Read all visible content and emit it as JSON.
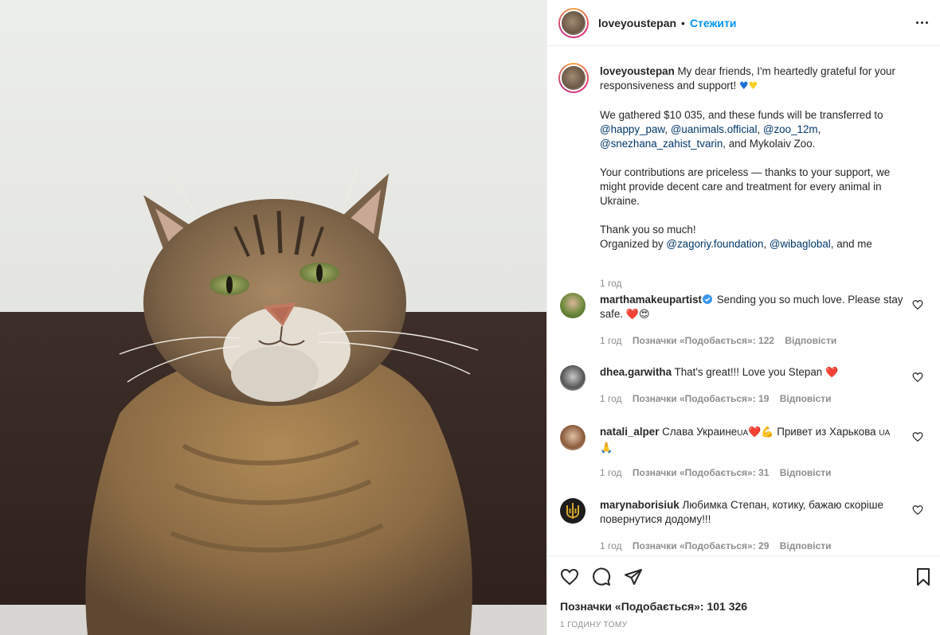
{
  "post": {
    "username": "loveyoustepan",
    "separator": "•",
    "follow_label": "Стежити",
    "caption": {
      "username": "loveyoustepan",
      "p1": "My dear friends, I'm heartedly grateful for your responsiveness and support!",
      "p2_start": "We gathered $10 035, and these funds will be transferred to",
      "mentions_1": [
        "@happy_paw",
        "@uanimals.official",
        "@zoo_12m",
        "@snezhana_zahist_tvarin"
      ],
      "p2_end": ", and Mykolaiv Zoo.",
      "p3": "Your contributions are priceless — thanks to your support, we might provide decent care and treatment for every animal in Ukraine.",
      "p4": "Thank you so much!",
      "p5_start": "Organized by",
      "mentions_2": [
        "@zagoriy.foundation",
        "@wibaglobal"
      ],
      "p5_end": ", and me",
      "time": "1 год"
    },
    "comments": [
      {
        "username": "marthamakeupartist",
        "verified": true,
        "text": "Sending you so much love. Please stay safe.",
        "emoji": "❤️😍",
        "time": "1 год",
        "likes": "Позначки «Подобається»: 122",
        "reply": "Відповісти"
      },
      {
        "username": "dhea.garwitha",
        "verified": false,
        "text": "That's great!!! Love you Stepan",
        "emoji": "❤️",
        "time": "1 год",
        "likes": "Позначки «Подобається»: 19",
        "reply": "Відповісти"
      },
      {
        "username": "natali_alper",
        "verified": false,
        "text_a": "Слава Украине",
        "flag_a": "UA",
        "emoji_a": "❤️💪",
        "text_b": "Привет из Харькова",
        "flag_b": "UA",
        "emoji_b": "🙏",
        "time": "1 год",
        "likes": "Позначки «Подобається»: 31",
        "reply": "Відповісти"
      },
      {
        "username": "marynaborisiuk",
        "verified": false,
        "text": "Любимка Степан, котику, бажаю скоріше повернутися додому!!!",
        "time": "1 год",
        "likes": "Позначки «Подобається»: 29",
        "reply": "Відповісти"
      }
    ],
    "likes_total": "Позначки «Подобається»: 101 326",
    "posted": "1 ГОДИНУ ТОМУ"
  },
  "icons": {
    "like": "heart-outline-icon",
    "comment": "comment-bubble-icon",
    "share": "paper-plane-icon",
    "save": "bookmark-icon",
    "more": "more-dots-icon",
    "verified": "verified-badge-icon"
  },
  "colors": {
    "link": "#00376b",
    "follow": "#0095f6",
    "muted": "#8e8e8e",
    "verified": "#3897f0"
  }
}
